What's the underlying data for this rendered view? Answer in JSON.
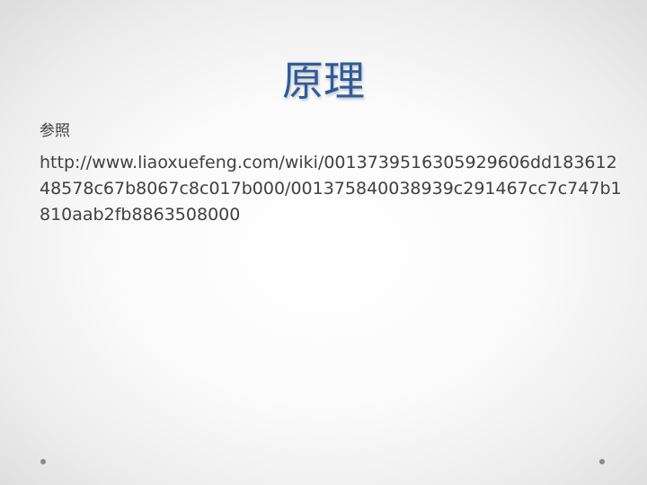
{
  "slide": {
    "title": "原理",
    "label": "参照",
    "link": "http://www.liaoxuefeng.com/wiki/0013739516305929606dd18361248578c67b8067c8c017b000/001375840038939c291467cc7c747b1810aab2fb8863508000"
  }
}
